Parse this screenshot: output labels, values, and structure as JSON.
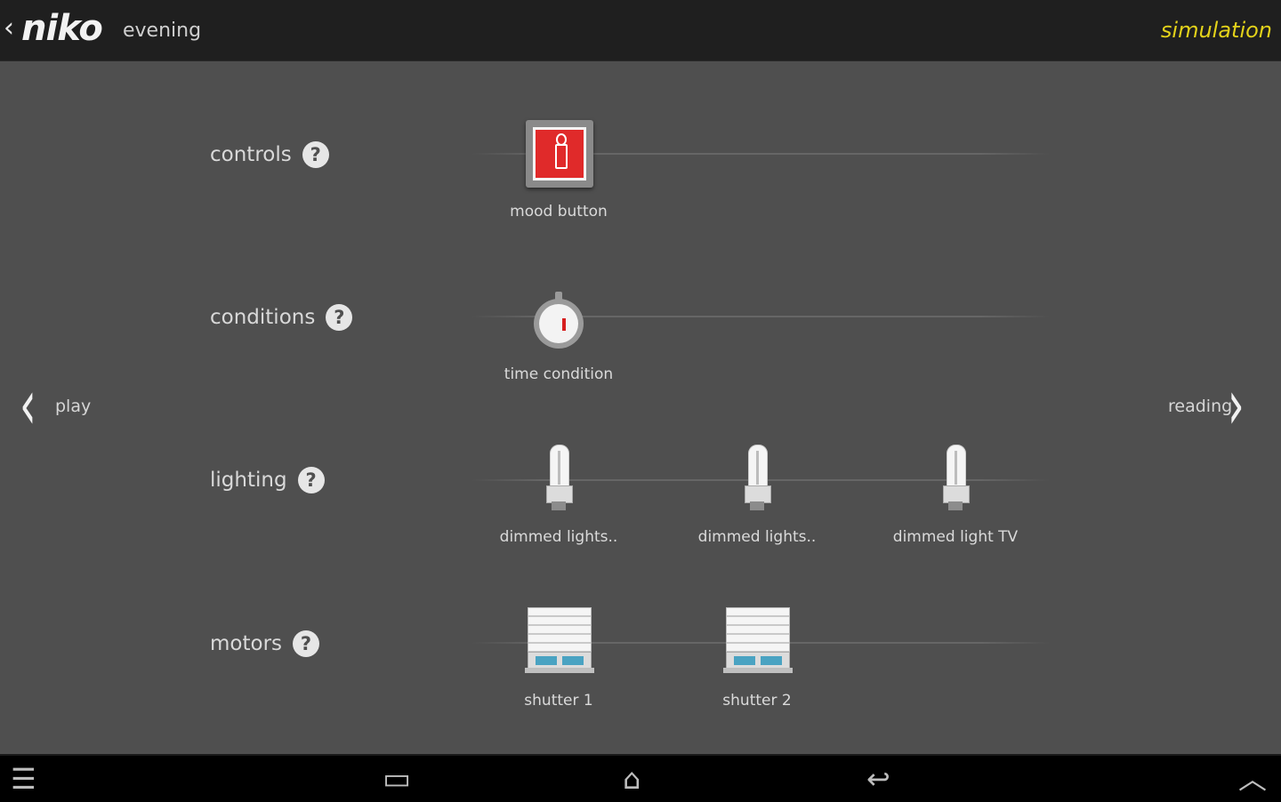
{
  "header": {
    "back_glyph": "‹",
    "logo": "niko",
    "subtitle": "evening",
    "mode_label": "simulation",
    "mode_color": "#e3d21a"
  },
  "rows": {
    "controls": {
      "label": "controls",
      "help": "?"
    },
    "conditions": {
      "label": "conditions",
      "help": "?"
    },
    "lighting": {
      "label": "lighting",
      "help": "?"
    },
    "motors": {
      "label": "motors",
      "help": "?"
    }
  },
  "items": {
    "mood_button": {
      "label": "mood button",
      "icon": "candle-icon"
    },
    "time_condition": {
      "label": "time condition",
      "icon": "stopwatch-icon"
    },
    "lights": [
      {
        "label": "dimmed lights..",
        "icon": "bulb-icon"
      },
      {
        "label": "dimmed lights..",
        "icon": "bulb-icon"
      },
      {
        "label": "dimmed light TV",
        "icon": "bulb-icon"
      }
    ],
    "shutters": [
      {
        "label": "shutter 1",
        "icon": "shutter-icon"
      },
      {
        "label": "shutter 2",
        "icon": "shutter-icon"
      }
    ]
  },
  "nav": {
    "prev_glyph": "‹",
    "prev_label": "play",
    "next_glyph": "›",
    "next_label": "reading"
  },
  "system_bar": {
    "menu_icon": "☰",
    "recent_icon": "▭",
    "home_icon": "⌂",
    "back_icon": "↩",
    "up_icon": "︿"
  }
}
